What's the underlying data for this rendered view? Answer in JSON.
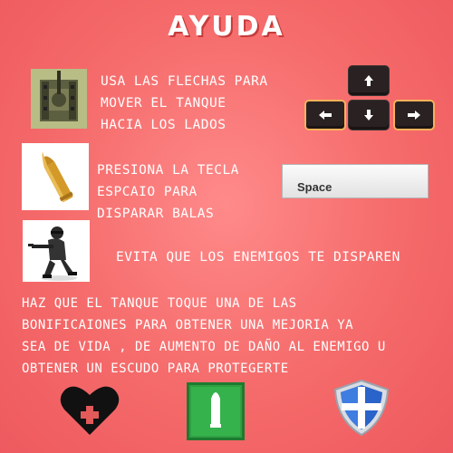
{
  "title": "AYUDA",
  "instructions": {
    "move": [
      "USA LAS FLECHAS PARA",
      "MOVER EL TANQUE",
      "HACIA LOS LADOS"
    ],
    "shoot": [
      "PRESIONA LA TECLA",
      "ESPCAIO PARA",
      "DISPARAR  BALAS"
    ],
    "avoid": "EVITA QUE LOS ENEMIGOS TE DISPAREN",
    "bonus": [
      "HAZ QUE EL TANQUE TOQUE UNA DE LAS",
      "BONIFICAIONES PARA OBTENER UNA MEJORIA YA",
      "SEA DE VIDA , DE AUMENTO DE DAÑO AL ENEMIGO U",
      "OBTENER UN ESCUDO PARA PROTEGERTE"
    ]
  },
  "keys": {
    "space_label": "Space",
    "arrows": [
      "arrow-up-icon",
      "arrow-left-icon",
      "arrow-down-icon",
      "arrow-right-icon"
    ]
  },
  "bonus_icons": [
    "heart-plus-icon",
    "ammo-icon",
    "shield-icon"
  ],
  "colors": {
    "background": "#f56a6a",
    "text": "#ffffff",
    "key": "#2a2222",
    "key_highlight": "#f7b25a"
  }
}
